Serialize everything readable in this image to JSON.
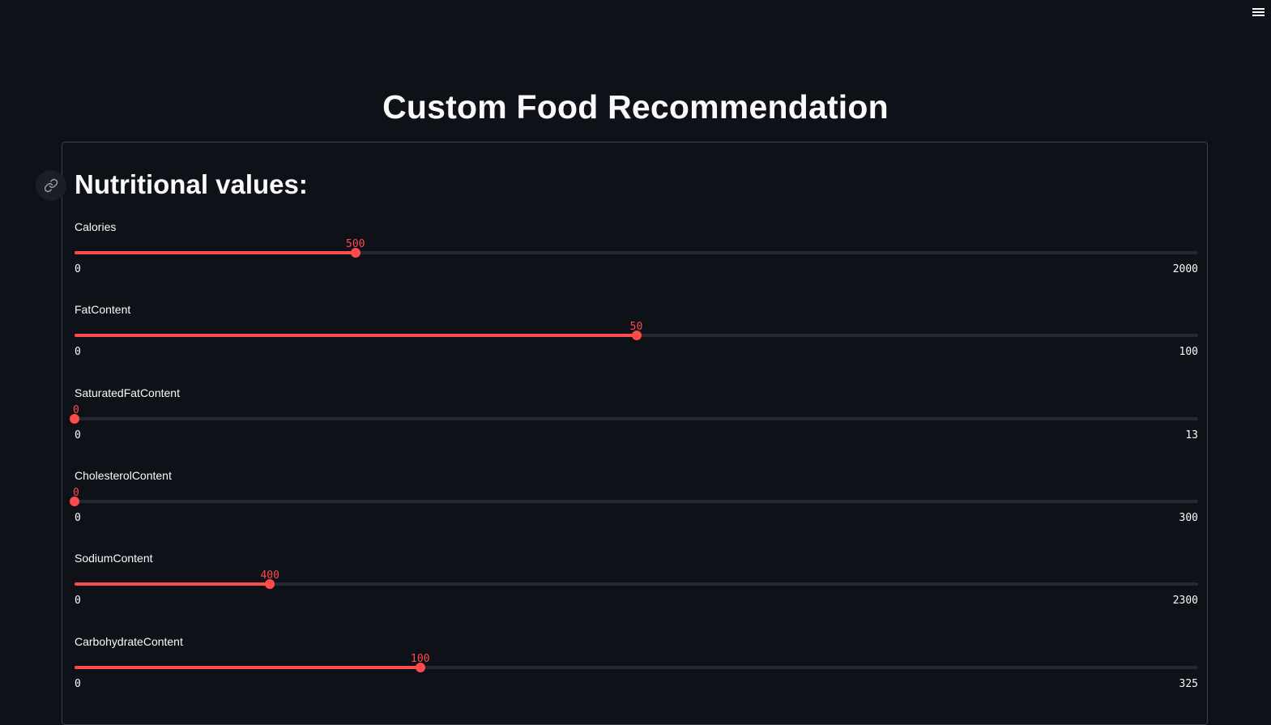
{
  "title": "Custom Food Recommendation",
  "form": {
    "heading": "Nutritional values:",
    "sliders": [
      {
        "label": "Calories",
        "value": "500",
        "min": "0",
        "max": "2000"
      },
      {
        "label": "FatContent",
        "value": "50",
        "min": "0",
        "max": "100"
      },
      {
        "label": "SaturatedFatContent",
        "value": "0",
        "min": "0",
        "max": "13"
      },
      {
        "label": "CholesterolContent",
        "value": "0",
        "min": "0",
        "max": "300"
      },
      {
        "label": "SodiumContent",
        "value": "400",
        "min": "0",
        "max": "2300"
      },
      {
        "label": "CarbohydrateContent",
        "value": "100",
        "min": "0",
        "max": "325"
      }
    ]
  },
  "colors": {
    "background": "#0e1117",
    "accent": "#ff4b4b",
    "track": "#262730",
    "text": "#fafafa"
  },
  "icons": {
    "menu": "hamburger-menu-icon",
    "anchor": "link-icon"
  }
}
